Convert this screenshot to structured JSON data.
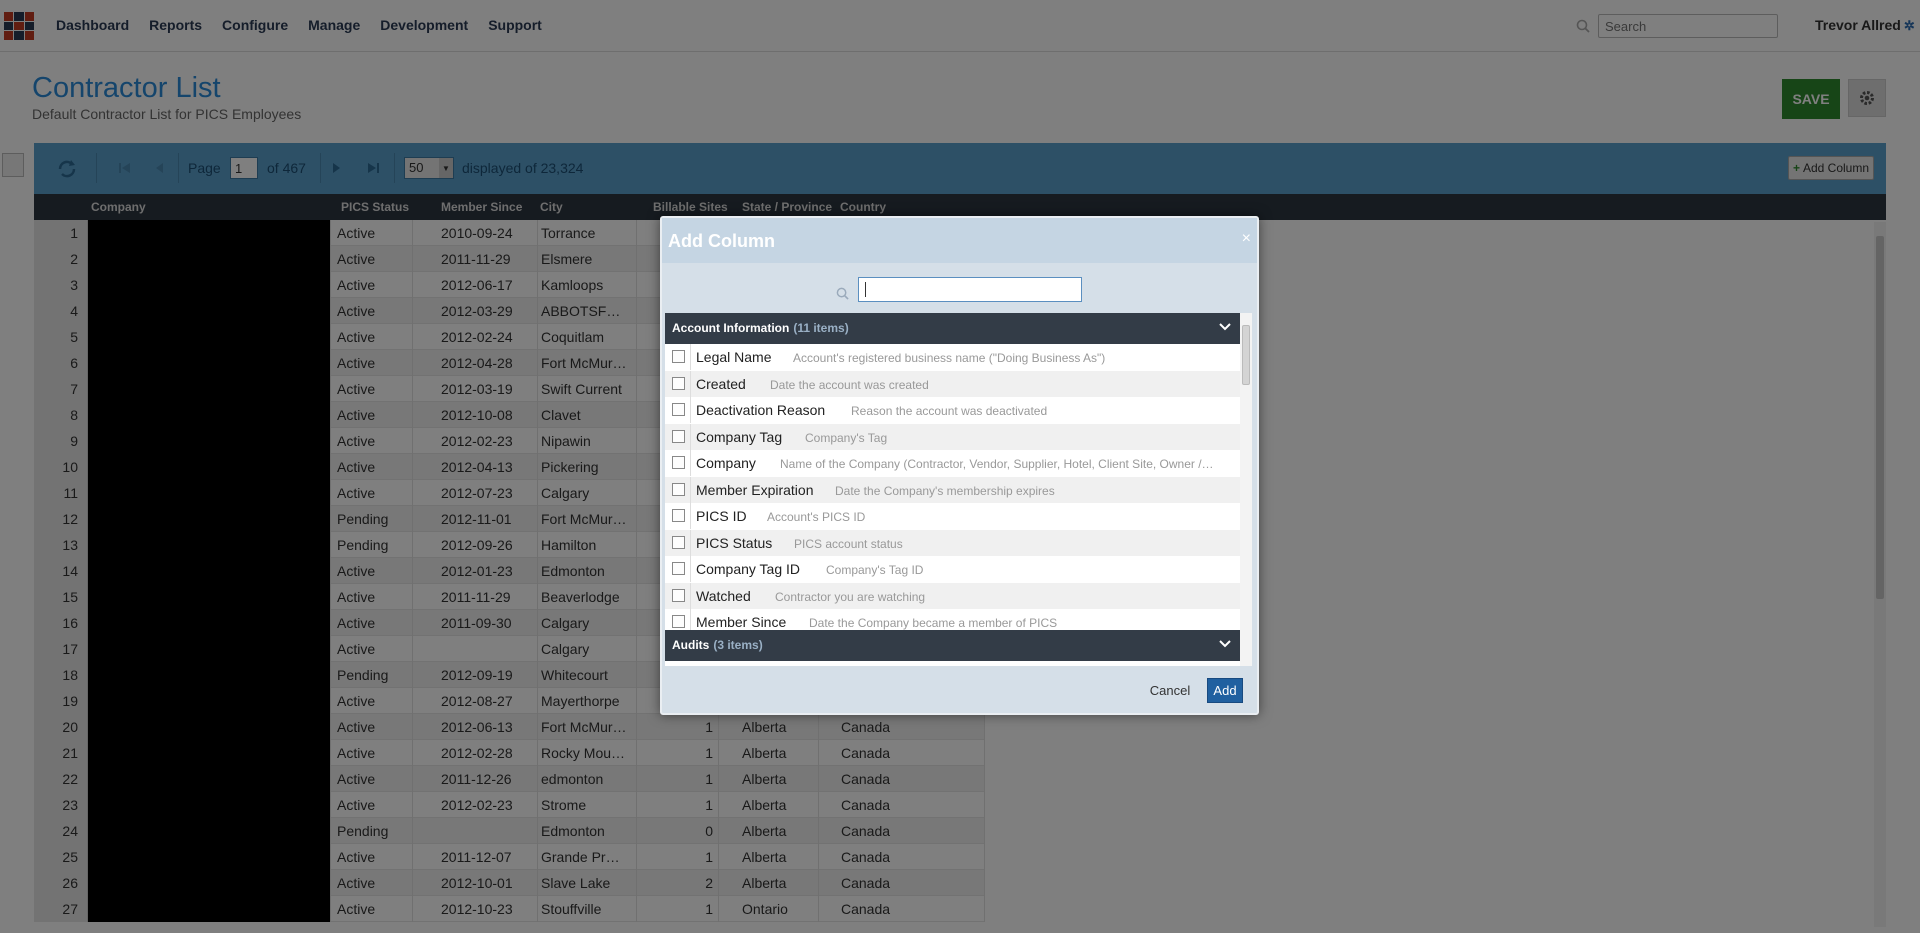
{
  "nav": {
    "items": [
      "Dashboard",
      "Reports",
      "Configure",
      "Manage",
      "Development",
      "Support"
    ],
    "search_placeholder": "Search",
    "user_name": "Trevor Allred"
  },
  "header": {
    "title": "Contractor List",
    "subtitle": "Default Contractor List for PICS Employees",
    "save_label": "SAVE"
  },
  "toolbar": {
    "page_label": "Page",
    "page_value": "1",
    "of_label": "of 467",
    "page_size": "50",
    "displayed": "displayed of 23,324",
    "add_column_label": "Add Column"
  },
  "grid": {
    "columns": [
      "Company",
      "PICS Status",
      "Member Since",
      "City",
      "Billable Sites",
      "State / Province",
      "Country"
    ],
    "rows": [
      {
        "n": "1",
        "status": "Active",
        "since": "2010-09-24",
        "city": "Torrance",
        "sites": "",
        "state": "",
        "country": ""
      },
      {
        "n": "2",
        "status": "Active",
        "since": "2011-11-29",
        "city": "Elsmere",
        "sites": "",
        "state": "",
        "country": ""
      },
      {
        "n": "3",
        "status": "Active",
        "since": "2012-06-17",
        "city": "Kamloops",
        "sites": "",
        "state": "",
        "country": ""
      },
      {
        "n": "4",
        "status": "Active",
        "since": "2012-03-29",
        "city": "ABBOTSF…",
        "sites": "",
        "state": "",
        "country": ""
      },
      {
        "n": "5",
        "status": "Active",
        "since": "2012-02-24",
        "city": "Coquitlam",
        "sites": "",
        "state": "",
        "country": ""
      },
      {
        "n": "6",
        "status": "Active",
        "since": "2012-04-28",
        "city": "Fort McMur…",
        "sites": "",
        "state": "",
        "country": ""
      },
      {
        "n": "7",
        "status": "Active",
        "since": "2012-03-19",
        "city": "Swift Current",
        "sites": "",
        "state": "",
        "country": ""
      },
      {
        "n": "8",
        "status": "Active",
        "since": "2012-10-08",
        "city": "Clavet",
        "sites": "",
        "state": "",
        "country": ""
      },
      {
        "n": "9",
        "status": "Active",
        "since": "2012-02-23",
        "city": "Nipawin",
        "sites": "",
        "state": "",
        "country": ""
      },
      {
        "n": "10",
        "status": "Active",
        "since": "2012-04-13",
        "city": "Pickering",
        "sites": "",
        "state": "",
        "country": ""
      },
      {
        "n": "11",
        "status": "Active",
        "since": "2012-07-23",
        "city": "Calgary",
        "sites": "",
        "state": "",
        "country": ""
      },
      {
        "n": "12",
        "status": "Pending",
        "since": "2012-11-01",
        "city": "Fort McMur…",
        "sites": "",
        "state": "",
        "country": ""
      },
      {
        "n": "13",
        "status": "Pending",
        "since": "2012-09-26",
        "city": "Hamilton",
        "sites": "",
        "state": "",
        "country": ""
      },
      {
        "n": "14",
        "status": "Active",
        "since": "2012-01-23",
        "city": "Edmonton",
        "sites": "",
        "state": "",
        "country": ""
      },
      {
        "n": "15",
        "status": "Active",
        "since": "2011-11-29",
        "city": "Beaverlodge",
        "sites": "",
        "state": "",
        "country": ""
      },
      {
        "n": "16",
        "status": "Active",
        "since": "2011-09-30",
        "city": "Calgary",
        "sites": "",
        "state": "",
        "country": ""
      },
      {
        "n": "17",
        "status": "Active",
        "since": "",
        "city": "Calgary",
        "sites": "",
        "state": "",
        "country": ""
      },
      {
        "n": "18",
        "status": "Pending",
        "since": "2012-09-19",
        "city": "Whitecourt",
        "sites": "",
        "state": "",
        "country": ""
      },
      {
        "n": "19",
        "status": "Active",
        "since": "2012-08-27",
        "city": "Mayerthorpe",
        "sites": "",
        "state": "",
        "country": ""
      },
      {
        "n": "20",
        "status": "Active",
        "since": "2012-06-13",
        "city": "Fort McMur…",
        "sites": "1",
        "state": "Alberta",
        "country": "Canada"
      },
      {
        "n": "21",
        "status": "Active",
        "since": "2012-02-28",
        "city": "Rocky Mou…",
        "sites": "1",
        "state": "Alberta",
        "country": "Canada"
      },
      {
        "n": "22",
        "status": "Active",
        "since": "2011-12-26",
        "city": "edmonton",
        "sites": "1",
        "state": "Alberta",
        "country": "Canada"
      },
      {
        "n": "23",
        "status": "Active",
        "since": "2012-02-23",
        "city": "Strome",
        "sites": "1",
        "state": "Alberta",
        "country": "Canada"
      },
      {
        "n": "24",
        "status": "Pending",
        "since": "",
        "city": "Edmonton",
        "sites": "0",
        "state": "Alberta",
        "country": "Canada"
      },
      {
        "n": "25",
        "status": "Active",
        "since": "2011-12-07",
        "city": "Grande Pr…",
        "sites": "1",
        "state": "Alberta",
        "country": "Canada"
      },
      {
        "n": "26",
        "status": "Active",
        "since": "2012-10-01",
        "city": "Slave Lake",
        "sites": "2",
        "state": "Alberta",
        "country": "Canada"
      },
      {
        "n": "27",
        "status": "Active",
        "since": "2012-10-23",
        "city": "Stouffville",
        "sites": "1",
        "state": "Ontario",
        "country": "Canada"
      }
    ]
  },
  "modal": {
    "title": "Add Column",
    "close": "×",
    "groups": [
      {
        "title": "Account Information",
        "count": "(11 items)"
      },
      {
        "title": "Audits",
        "count": "(3 items)"
      }
    ],
    "items": [
      {
        "name": "Legal Name",
        "desc": "Account's registered business name (\"Doing Business As\")"
      },
      {
        "name": "Created",
        "desc": "Date the account was created"
      },
      {
        "name": "Deactivation Reason",
        "desc": "Reason the account was deactivated"
      },
      {
        "name": "Company Tag",
        "desc": "Company's Tag"
      },
      {
        "name": "Company",
        "desc": "Name of the Company (Contractor, Vendor, Supplier, Hotel, Client Site, Owner /…"
      },
      {
        "name": "Member Expiration",
        "desc": "Date the Company's membership expires"
      },
      {
        "name": "PICS ID",
        "desc": "Account's PICS ID"
      },
      {
        "name": "PICS Status",
        "desc": "PICS account status"
      },
      {
        "name": "Company Tag ID",
        "desc": "Company's Tag ID"
      },
      {
        "name": "Watched",
        "desc": "Contractor you are watching"
      },
      {
        "name": "Member Since",
        "desc": "Date the Company became a member of PICS"
      }
    ],
    "cancel_label": "Cancel",
    "add_label": "Add"
  },
  "colors": {
    "accent": "#2a8ad8",
    "toolbar": "#5aa0cc",
    "save": "#2f8a2f",
    "grid_header": "#2d3640",
    "modal_add": "#2060a0"
  }
}
